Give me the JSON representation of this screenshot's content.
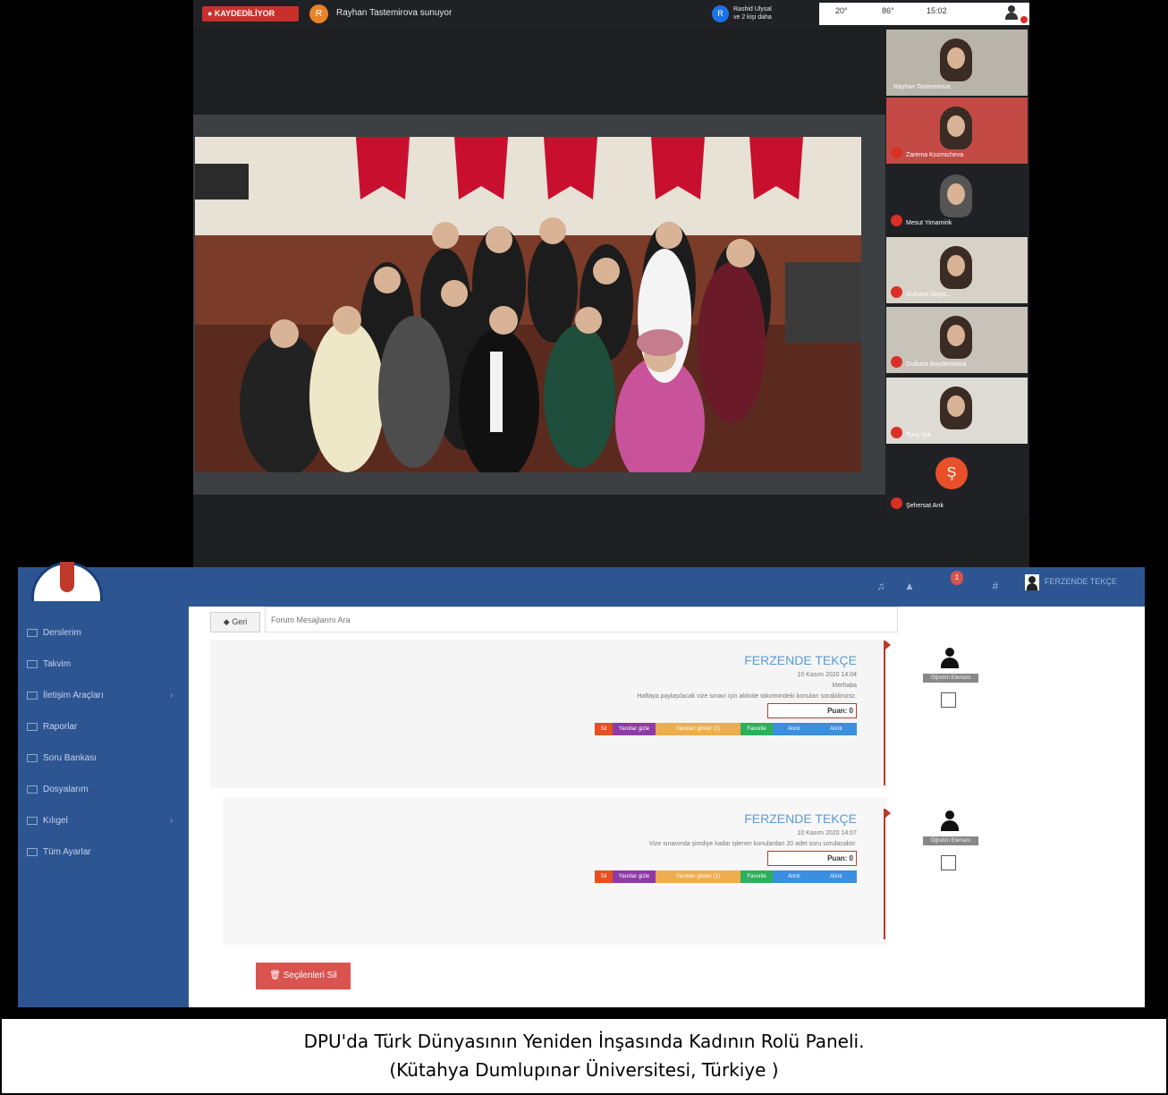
{
  "meet": {
    "rec_label": "● KAYDEDİLİYOR",
    "presenter_initial": "R",
    "presenter_text": "Rayhan Tastemirova sunuyor",
    "guest_initial": "R",
    "guest_line1": "Rashid Ulysal",
    "guest_line2": "ve 2 kişi daha",
    "ctrl_a": "20°",
    "ctrl_b": "86°",
    "time": "15:02",
    "participants": [
      {
        "name": "Rayhan Tastemirova"
      },
      {
        "name": "Zarema Kozmicheva"
      },
      {
        "name": "Mesut Yimamirik"
      },
      {
        "name": "Gulnara Stoya..."
      },
      {
        "name": "Gulbara Baydemirova"
      },
      {
        "name": "Tunç Işık"
      },
      {
        "name": "Şehersat Arık",
        "initial": "Ş"
      }
    ]
  },
  "lms": {
    "user_name": "FERZENDE TEKÇE",
    "notif_count": "1",
    "nav": [
      {
        "label": "Derslerim"
      },
      {
        "label": "Takvim"
      },
      {
        "label": "İletişim Araçları",
        "chevron": "›"
      },
      {
        "label": "Raporlar"
      },
      {
        "label": "Soru Bankası"
      },
      {
        "label": "Dosyalarım"
      },
      {
        "label": "Kılıgel",
        "chevron": "›"
      },
      {
        "label": "Tüm Ayarlar"
      }
    ],
    "back_label": "◆ Geri",
    "search_placeholder": "Forum Mesajlarını Ara",
    "posts": [
      {
        "author": "FERZENDE TEKÇE",
        "date": "10 Kasım 2020 14:04",
        "greeting": "Merhaba",
        "text": "Haftaya paylaşılacak vize sınavı için aktivite takvimindeki konuları sorabilirsiniz.",
        "score_label": "Puan: 0",
        "btns": [
          "Sil",
          "Yanıtlar gizle",
          "Yanıtları göster (1)",
          "Favorile",
          "Alıntı",
          "Alıntı"
        ],
        "user_tag": "Öğretim Elemanı"
      },
      {
        "author": "FERZENDE TEKÇE",
        "date": "10 Kasım 2020 14:07",
        "text": "Vize sınavında şimdiye kadar işlenen konulardan 20 adet soru sorulacaktır.",
        "score_label": "Puan: 0",
        "btns": [
          "Sil",
          "Yanıtlar gizle",
          "Yanıtları göster (1)",
          "Favorile",
          "Alıntı",
          "Alıntı"
        ],
        "user_tag": "Öğretim Elemanı"
      }
    ],
    "delete_selected": "🗑 Seçilenleri Sil"
  },
  "caption": {
    "line1": "DPU'da Türk Dünyasının Yeniden İnşasında Kadının Rolü Paneli.",
    "line2": "(Kütahya Dumlupınar Üniversitesi, Türkiye )"
  }
}
